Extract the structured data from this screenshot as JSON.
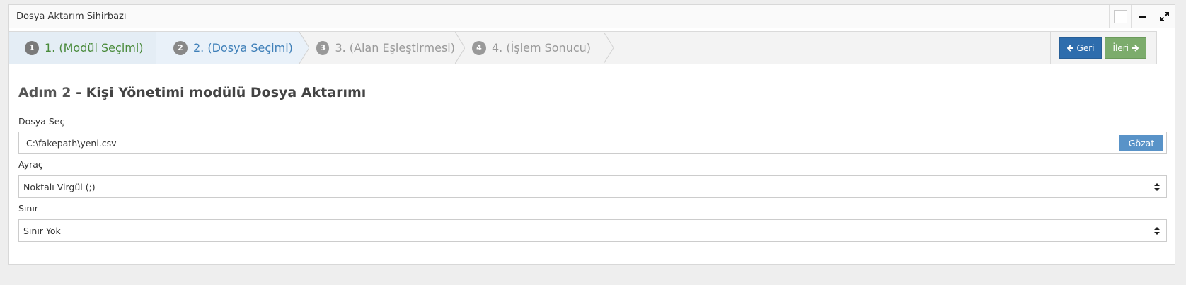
{
  "portlet": {
    "title": "Dosya Aktarım Sihirbazı"
  },
  "wizard": {
    "steps": [
      {
        "number": "1",
        "label": "1. (Modül Seçimi)"
      },
      {
        "number": "2",
        "label": "2. (Dosya Seçimi)"
      },
      {
        "number": "3",
        "label": "3. (Alan Eşleştirmesi)"
      },
      {
        "number": "4",
        "label": "4. (İşlem Sonucu)"
      }
    ],
    "back_label": "Geri",
    "next_label": "İleri"
  },
  "heading": {
    "step": "Adım 2",
    "rest": " - Kişi Yönetimi modülü Dosya Aktarımı"
  },
  "form": {
    "file": {
      "label": "Dosya Seç",
      "value": "C:\\fakepath\\yeni.csv",
      "browse_label": "Gözat"
    },
    "separator": {
      "label": "Ayraç",
      "value": "Noktalı Virgül (;)"
    },
    "delimiter": {
      "label": "Sınır",
      "value": "Sınır Yok"
    }
  },
  "colors": {
    "primary": "#2e6dad",
    "success": "#7cac6c",
    "active_step_text": "#3e7fb8",
    "done_step_text": "#4a8b3c"
  }
}
